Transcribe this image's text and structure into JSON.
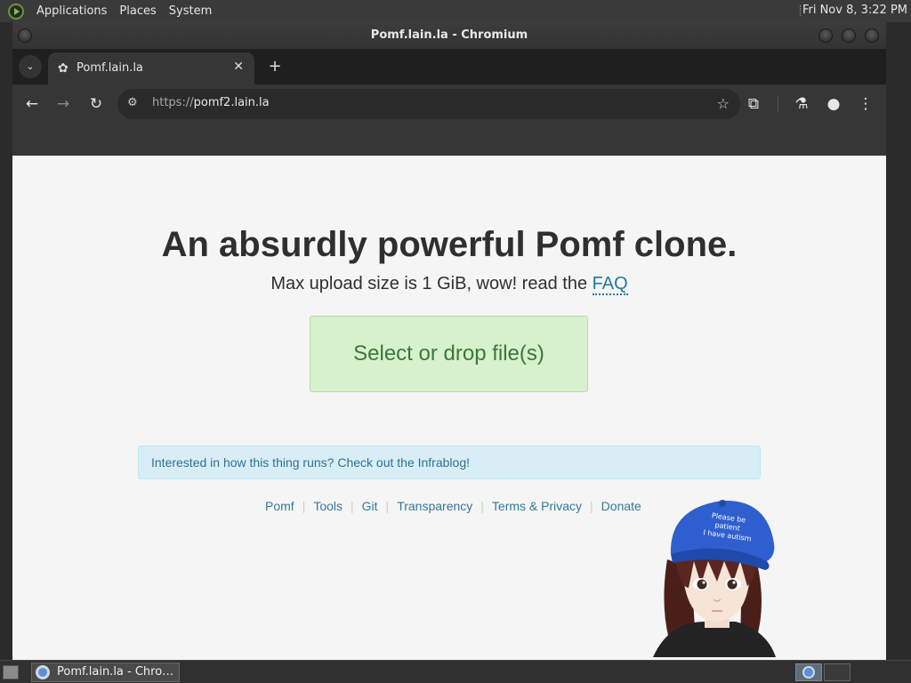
{
  "top_panel": {
    "menus": [
      "Applications",
      "Places",
      "System"
    ],
    "clock": "Fri Nov  8,  3:22 PM"
  },
  "window": {
    "title": "Pomf.lain.la - Chromium"
  },
  "browser": {
    "tab": {
      "title": "Pomf.lain.la",
      "close": "✕"
    },
    "new_tab": "+",
    "tab_search": "⌄",
    "url_scheme": "https://",
    "url_host": "pomf2.lain.la",
    "icons": {
      "back": "←",
      "forward": "→",
      "reload": "↻",
      "site_info": "⚙",
      "bookmark": "☆",
      "extensions": "⧉",
      "labs": "⚗",
      "profile": "●",
      "menu": "⋮"
    }
  },
  "page": {
    "headline": "An absurdly powerful Pomf clone.",
    "subline_prefix": "Max upload size is 1 GiB, wow! read the ",
    "faq_link": "FAQ",
    "upload_button": "Select or drop file(s)",
    "alert": "Interested in how this thing runs? Check out the Infrablog!",
    "footer_links": [
      "Pomf",
      "Tools",
      "Git",
      "Transparency",
      "Terms & Privacy",
      "Donate"
    ],
    "mascot_cap_text": "Please be patient I have autism"
  },
  "taskbar": {
    "task_label": "Pomf.lain.la - Chro…"
  }
}
